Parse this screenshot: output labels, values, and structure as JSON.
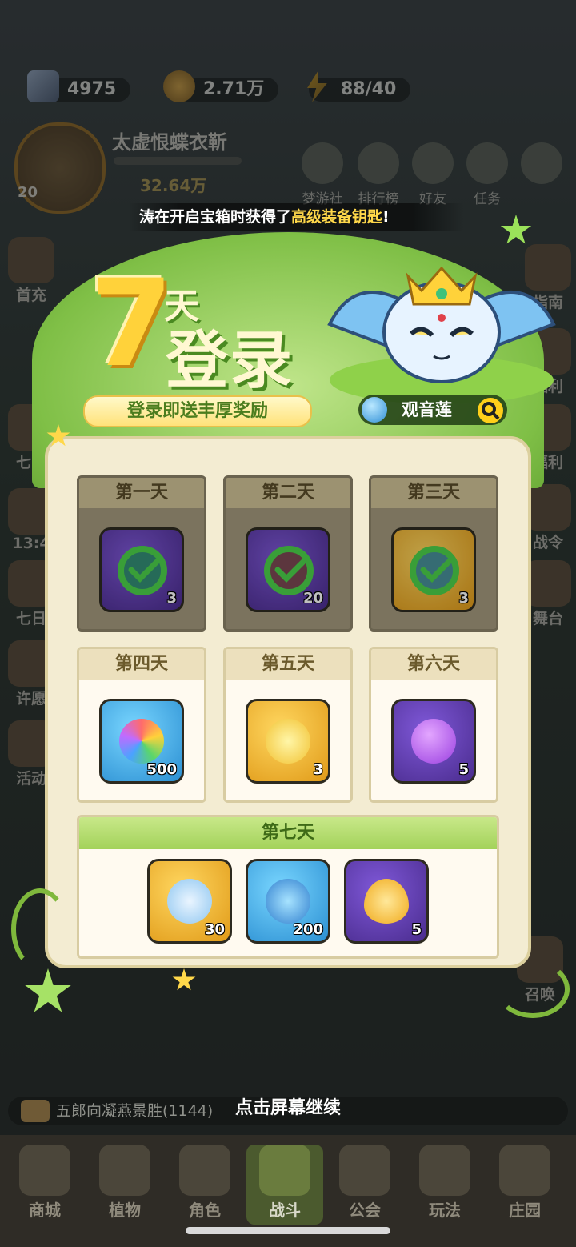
{
  "resources": [
    {
      "icon": "diamond-icon",
      "value": "4975"
    },
    {
      "icon": "gold-coin-icon",
      "value": "2.71万"
    },
    {
      "icon": "energy-icon",
      "value": "88/40"
    }
  ],
  "player": {
    "name": "太虚恨蝶衣靳",
    "level": "20",
    "power": "32.64万"
  },
  "top_buttons": [
    "梦游社",
    "排行榜",
    "好友",
    "任务"
  ],
  "side_left": [
    "首充",
    "七日",
    "七日",
    "许愿",
    "活动"
  ],
  "side_left_timer": "13:4",
  "side_right": [
    "指南",
    "福利",
    "福利",
    "战令",
    "舞台",
    "召唤"
  ],
  "notice": {
    "prefix": "涛在开启宝箱时获得了",
    "highlight": "高级装备钥匙",
    "suffix": "!"
  },
  "popup": {
    "title_number": "7",
    "title_day": "天",
    "title_main": "登录",
    "subtitle": "登录即送丰厚奖励",
    "pet_name": "观音莲",
    "days": [
      {
        "label": "第一天",
        "claimed": true,
        "count": "3",
        "item_color": "purple"
      },
      {
        "label": "第二天",
        "claimed": true,
        "count": "20",
        "item_color": "purple"
      },
      {
        "label": "第三天",
        "claimed": true,
        "count": "3",
        "item_color": "gold"
      },
      {
        "label": "第四天",
        "claimed": false,
        "count": "500",
        "item_color": "blue"
      },
      {
        "label": "第五天",
        "claimed": false,
        "count": "3",
        "item_color": "gold"
      },
      {
        "label": "第六天",
        "claimed": false,
        "count": "5",
        "item_color": "purple"
      }
    ],
    "day7": {
      "label": "第七天",
      "items": [
        {
          "count": "30",
          "item_color": "gold",
          "icon": "pet-fragment-icon"
        },
        {
          "count": "200",
          "item_color": "blue",
          "icon": "water-orb-icon"
        },
        {
          "count": "5",
          "item_color": "purple",
          "icon": "golden-drop-icon"
        }
      ]
    }
  },
  "continue_hint": "点击屏幕继续",
  "chat_preview": "五郎向凝燕景胜(1144)",
  "nav": [
    "商城",
    "植物",
    "角色",
    "战斗",
    "公会",
    "玩法",
    "庄园"
  ],
  "nav_active": "战斗",
  "colors": {
    "accent_green": "#7fbf46",
    "gold": "#ffd23a",
    "panel": "#f3ecd2"
  }
}
